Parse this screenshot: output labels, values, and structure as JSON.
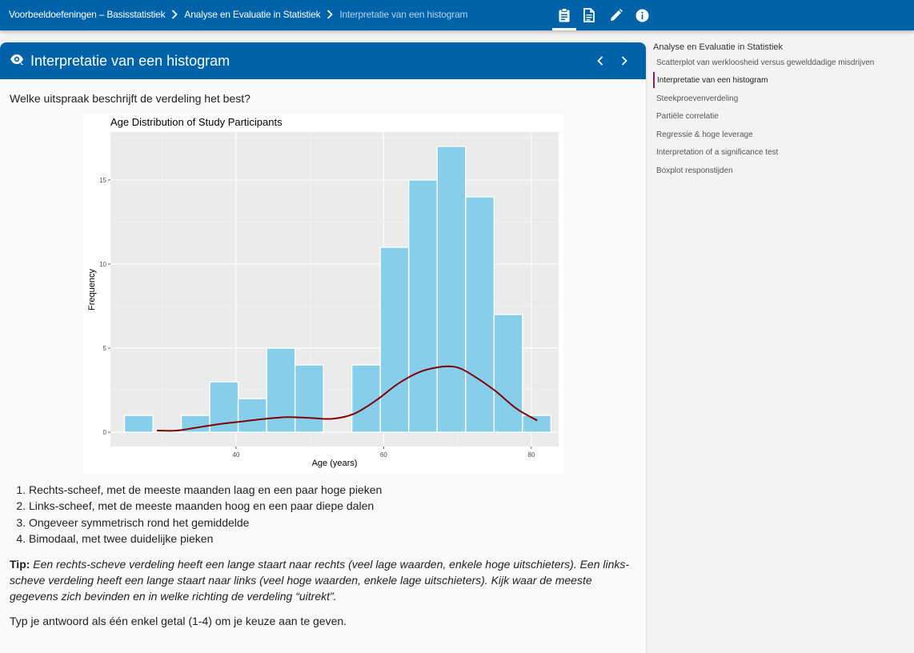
{
  "breadcrumb": {
    "items": [
      "Voorbeeldoefeningen – Basisstatistiek",
      "Analyse en Evaluatie in Statistiek",
      "Interpretatie van een histogram"
    ]
  },
  "toolbar": {
    "icons": [
      "clipboard-icon",
      "document-icon",
      "pencil-icon",
      "info-icon"
    ],
    "active_icon": "clipboard-icon"
  },
  "exercise": {
    "title": "Interpretatie van een histogram",
    "question": "Welke uitspraak beschrijft de verdeling het best?",
    "options": [
      "Rechts-scheef, met de meeste maanden laag en een paar hoge pieken",
      "Links-scheef, met de meeste maanden hoog en een paar diepe dalen",
      "Ongeveer symmetrisch rond het gemiddelde",
      "Bimodaal, met twee duidelijke pieken"
    ],
    "tip_label": "Tip:",
    "tip_text": "Een rechts-scheve verdeling heeft een lange staart naar rechts (veel lage waarden, enkele hoge uitschieters). Een links-scheve verdeling heeft een lange staart naar links (veel hoge waarden, enkele lage uitschieters). Kijk waar de meeste gegevens zich bevinden en in welke richting de verdeling “uitrekt”.",
    "answer_note": "Typ je antwoord als één enkel getal (1-4) om je keuze aan te geven."
  },
  "sidebar": {
    "heading": "Analyse en Evaluatie in Statistiek",
    "items": [
      "Scatterplot van werkloosheid versus gewelddadige misdrijven",
      "Interpretatie van een histogram",
      "Steekproevenverdeling",
      "Partiële correlatie",
      "Regressie & hoge leverage",
      "Interpretation of a significance test",
      "Boxplot responstijden"
    ],
    "active_index": 1
  },
  "colors": {
    "brand_blue": "#0062a8",
    "bar_fill": "#87ceeb",
    "density_line": "#800000",
    "panel_bg": "#ebebeb",
    "active_marker": "#8e1e55"
  },
  "chart_data": {
    "type": "bar",
    "title": "Age Distribution of Study Participants",
    "xlabel": "Age (years)",
    "ylabel": "Frequency",
    "bin_width": 3.85,
    "bins": [
      {
        "start": 24.9,
        "count": 1
      },
      {
        "start": 28.75,
        "count": 0
      },
      {
        "start": 32.6,
        "count": 1
      },
      {
        "start": 36.45,
        "count": 3
      },
      {
        "start": 40.3,
        "count": 2
      },
      {
        "start": 44.15,
        "count": 5
      },
      {
        "start": 48.0,
        "count": 4
      },
      {
        "start": 51.85,
        "count": 0
      },
      {
        "start": 55.7,
        "count": 4
      },
      {
        "start": 59.55,
        "count": 11
      },
      {
        "start": 63.4,
        "count": 15
      },
      {
        "start": 67.25,
        "count": 17
      },
      {
        "start": 71.1,
        "count": 14
      },
      {
        "start": 74.95,
        "count": 7
      },
      {
        "start": 78.8,
        "count": 1
      }
    ],
    "density_curve": {
      "x": [
        29.3,
        32,
        35,
        38,
        41,
        44,
        47,
        50,
        53,
        56,
        59,
        62,
        65,
        68,
        70,
        72,
        75,
        78,
        80.8
      ],
      "y": [
        0.1,
        0.1,
        0.3,
        0.5,
        0.65,
        0.8,
        0.9,
        0.85,
        0.8,
        1.1,
        1.9,
        2.9,
        3.6,
        3.9,
        3.85,
        3.4,
        2.5,
        1.4,
        0.7
      ]
    },
    "x_ticks": [
      40,
      60,
      80
    ],
    "y_ticks": [
      0,
      5,
      10,
      15
    ],
    "xlim": [
      23.0,
      83.7
    ],
    "ylim": [
      -0.85,
      17.85
    ],
    "grid": true,
    "legend": "none"
  }
}
